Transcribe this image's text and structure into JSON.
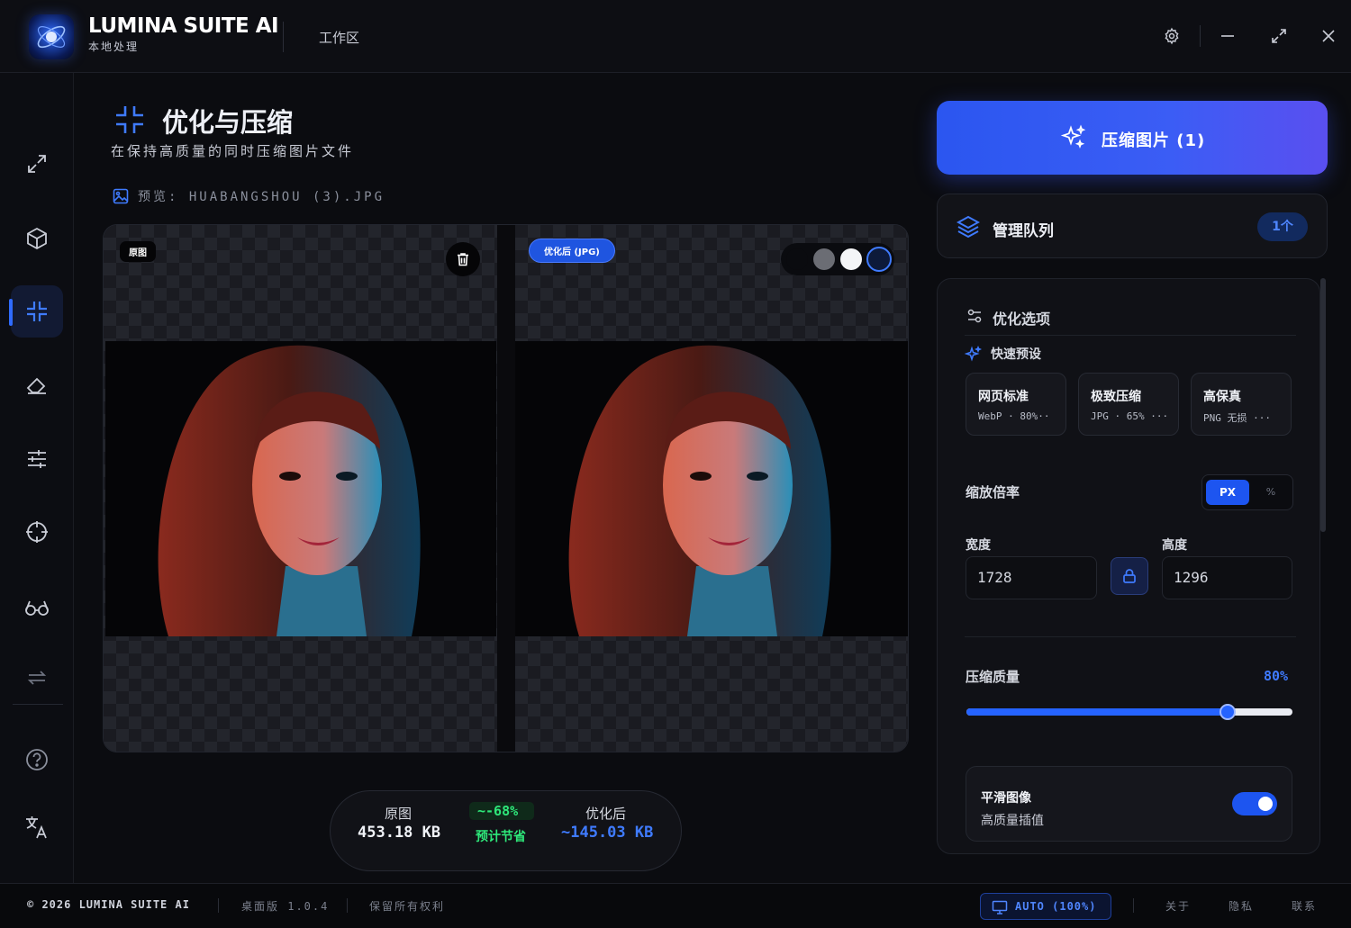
{
  "app": {
    "title": "LUMINA SUITE AI",
    "subtitle": "本地处理",
    "workspace": "工作区"
  },
  "sidebar": {
    "items": [
      {
        "name": "resize",
        "icon": "expand-arrows-icon",
        "active": false
      },
      {
        "name": "3d",
        "icon": "cube-icon",
        "active": false
      },
      {
        "name": "compress",
        "icon": "compress-icon",
        "active": true
      },
      {
        "name": "erase",
        "icon": "eraser-icon",
        "active": false
      },
      {
        "name": "adjust",
        "icon": "sliders-icon",
        "active": false
      },
      {
        "name": "target",
        "icon": "crosshair-icon",
        "active": false
      },
      {
        "name": "compare",
        "icon": "glasses-icon",
        "active": false
      },
      {
        "name": "convert",
        "icon": "repeat-icon",
        "active": false
      },
      {
        "name": "help",
        "icon": "help-icon",
        "active": false
      },
      {
        "name": "language",
        "icon": "translate-icon",
        "active": false
      }
    ]
  },
  "page": {
    "title": "优化与压缩",
    "subtitle": "在保持高质量的同时压缩图片文件",
    "preview_label": "预览: HUABANGSHOU (3).JPG"
  },
  "preview": {
    "original_badge": "原图",
    "optimized_badge": "优化后 (JPG)",
    "bg_swatches": [
      "#0a0b0f",
      "#6b6d74",
      "#f4f5f7",
      "#0d1a3a"
    ]
  },
  "stats": {
    "original_label": "原图",
    "original_size": "453.18 KB",
    "savings_percent": "~-68%",
    "savings_label": "预计节省",
    "optimized_label": "优化后",
    "optimized_size": "~145.03 KB"
  },
  "actions": {
    "compress_label": "压缩图片 (1)",
    "queue_label": "管理队列",
    "queue_count": "1个"
  },
  "options": {
    "title": "优化选项",
    "presets_label": "快速预设",
    "presets": [
      {
        "name": "网页标准",
        "spec": "WebP · 80%··"
      },
      {
        "name": "极致压缩",
        "spec": "JPG · 65% ···"
      },
      {
        "name": "高保真",
        "spec": "PNG 无损 ···"
      }
    ],
    "scale_label": "缩放倍率",
    "unit_px": "PX",
    "unit_pct": "%",
    "width_label": "宽度",
    "width_value": "1728",
    "height_label": "高度",
    "height_value": "1296",
    "quality_label": "压缩质量",
    "quality_value": "80%",
    "quality_fraction": 0.8,
    "smooth_title": "平滑图像",
    "smooth_subtitle": "高质量插值",
    "smooth_enabled": true
  },
  "footer": {
    "copyright": "© 2026 LUMINA SUITE AI",
    "version": "桌面版 1.0.4",
    "rights": "保留所有权利",
    "zoom": "AUTO (100%)",
    "about": "关于",
    "privacy": "隐私",
    "contact": "联系"
  },
  "colors": {
    "accent": "#2563ff",
    "savings_green": "#2ee87a",
    "background": "#0b0c10"
  }
}
